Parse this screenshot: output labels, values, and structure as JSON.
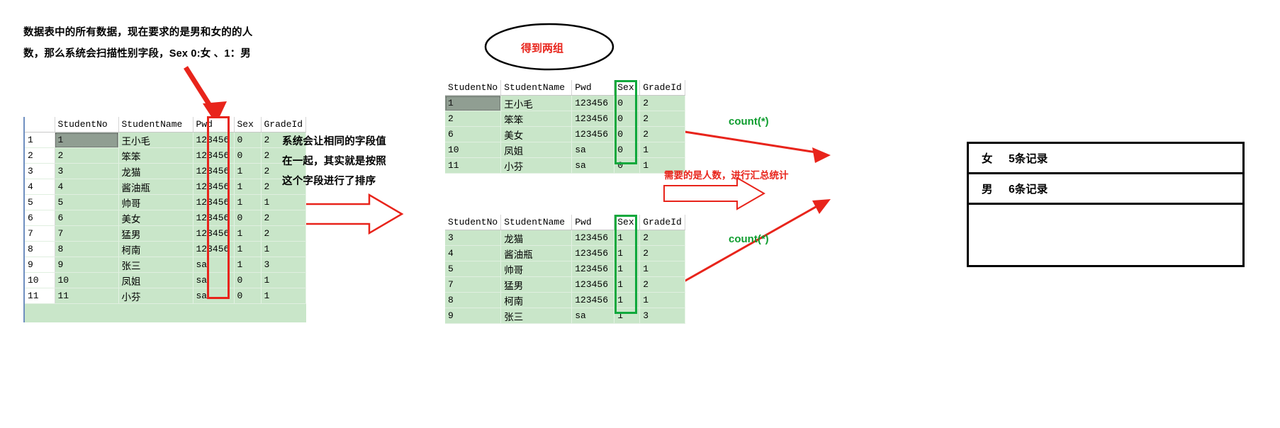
{
  "notes": {
    "intro_line1": "数据表中的所有数据，现在要求的是男和女的的人",
    "intro_line2": "数，那么系统会扫描性别字段，Sex 0:女 、1：男",
    "sort_line1": "系统会让相同的字段值",
    "sort_line2": "在一起，其实就是按照",
    "sort_line3": "这个字段进行了排序",
    "two_groups": "得到两组",
    "need_count": "需要的是人数，进行汇总统计",
    "count_top": "count(*)",
    "count_bottom": "count(*)"
  },
  "left_table": {
    "headers": [
      "",
      "StudentNo",
      "StudentName",
      "Pwd",
      "Sex",
      "GradeId"
    ],
    "rows": [
      [
        "1",
        "1",
        "王小毛",
        "123456",
        "0",
        "2"
      ],
      [
        "2",
        "2",
        "笨笨",
        "123456",
        "0",
        "2"
      ],
      [
        "3",
        "3",
        "龙猫",
        "123456",
        "1",
        "2"
      ],
      [
        "4",
        "4",
        "酱油瓶",
        "123456",
        "1",
        "2"
      ],
      [
        "5",
        "5",
        "帅哥",
        "123456",
        "1",
        "1"
      ],
      [
        "6",
        "6",
        "美女",
        "123456",
        "0",
        "2"
      ],
      [
        "7",
        "7",
        "猛男",
        "123456",
        "1",
        "2"
      ],
      [
        "8",
        "8",
        "柯南",
        "123456",
        "1",
        "1"
      ],
      [
        "9",
        "9",
        "张三",
        "sa",
        "1",
        "3"
      ],
      [
        "10",
        "10",
        "凤姐",
        "sa",
        "0",
        "1"
      ],
      [
        "11",
        "11",
        "小芬",
        "sa",
        "0",
        "1"
      ]
    ]
  },
  "female_table": {
    "headers": [
      "StudentNo",
      "StudentName",
      "Pwd",
      "Sex",
      "GradeId"
    ],
    "rows": [
      [
        "1",
        "王小毛",
        "123456",
        "0",
        "2"
      ],
      [
        "2",
        "笨笨",
        "123456",
        "0",
        "2"
      ],
      [
        "6",
        "美女",
        "123456",
        "0",
        "2"
      ],
      [
        "10",
        "凤姐",
        "sa",
        "0",
        "1"
      ],
      [
        "11",
        "小芬",
        "sa",
        "0",
        "1"
      ]
    ]
  },
  "male_table": {
    "headers": [
      "StudentNo",
      "StudentName",
      "Pwd",
      "Sex",
      "GradeId"
    ],
    "rows": [
      [
        "3",
        "龙猫",
        "123456",
        "1",
        "2"
      ],
      [
        "4",
        "酱油瓶",
        "123456",
        "1",
        "2"
      ],
      [
        "5",
        "帅哥",
        "123456",
        "1",
        "1"
      ],
      [
        "7",
        "猛男",
        "123456",
        "1",
        "2"
      ],
      [
        "8",
        "柯南",
        "123456",
        "1",
        "1"
      ],
      [
        "9",
        "张三",
        "sa",
        "1",
        "3"
      ]
    ]
  },
  "result": {
    "female_label": "女",
    "female_count": "5条记录",
    "male_label": "男",
    "male_count": "6条记录"
  },
  "colors": {
    "red": "#e8241b",
    "green": "#0fa83c",
    "count_green": "#0f9d2f",
    "grid_green": "#c9e6c9",
    "selected_gray": "#909e92"
  }
}
